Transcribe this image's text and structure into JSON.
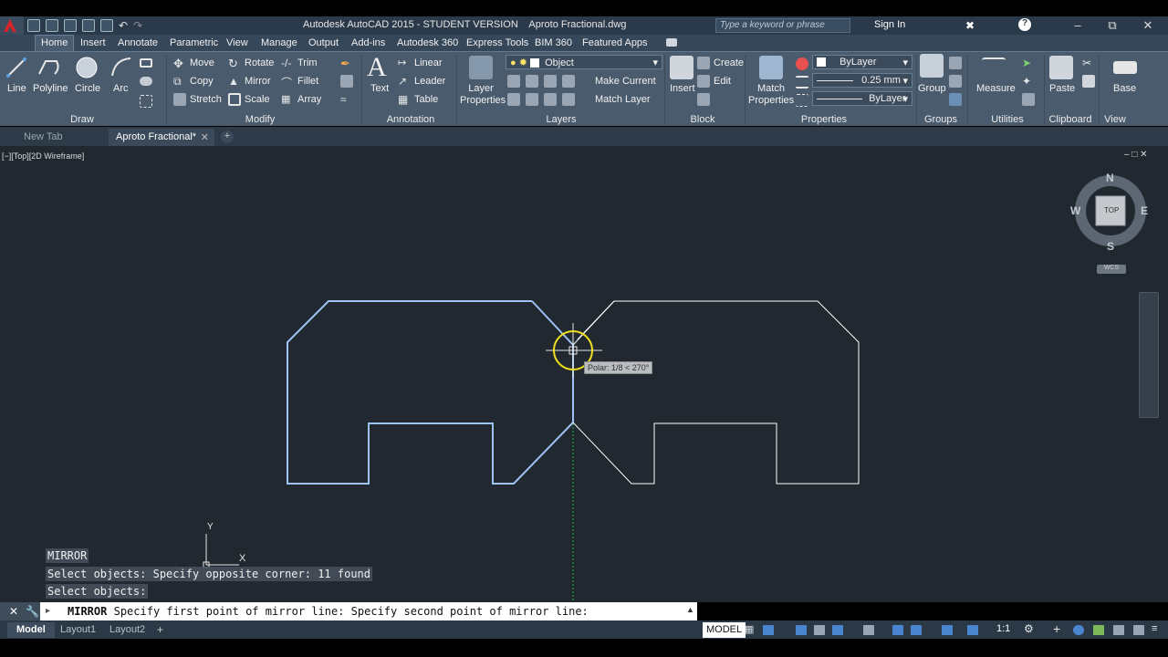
{
  "window": {
    "title": "Autodesk AutoCAD 2015 - STUDENT VERSION    Aproto Fractional.dwg",
    "search_placeholder": "Type a keyword or phrase",
    "sign_in": "Sign In"
  },
  "menu_tabs": [
    "Home",
    "Insert",
    "Annotate",
    "Parametric",
    "View",
    "Manage",
    "Output",
    "Add-ins",
    "Autodesk 360",
    "Express Tools",
    "BIM 360",
    "Featured Apps"
  ],
  "ribbon": {
    "draw": {
      "title": "Draw",
      "line": "Line",
      "polyline": "Polyline",
      "circle": "Circle",
      "arc": "Arc"
    },
    "modify": {
      "title": "Modify",
      "move": "Move",
      "rotate": "Rotate",
      "trim": "Trim",
      "copy": "Copy",
      "mirror": "Mirror",
      "fillet": "Fillet",
      "stretch": "Stretch",
      "scale": "Scale",
      "array": "Array"
    },
    "annotation": {
      "title": "Annotation",
      "text": "Text",
      "linear": "Linear",
      "leader": "Leader",
      "table": "Table"
    },
    "layers": {
      "title": "Layers",
      "layer_properties": "Layer Properties",
      "layer_name": "Object",
      "make_current": "Make Current",
      "match_layer": "Match Layer"
    },
    "block": {
      "title": "Block",
      "insert": "Insert",
      "create": "Create",
      "edit": "Edit"
    },
    "properties": {
      "title": "Properties",
      "match_properties": "Match Properties",
      "color": "ByLayer",
      "lineweight": "0.25 mm",
      "linetype": "ByLayer"
    },
    "groups": {
      "title": "Groups",
      "group": "Group"
    },
    "utilities": {
      "title": "Utilities",
      "measure": "Measure"
    },
    "clipboard": {
      "title": "Clipboard",
      "paste": "Paste"
    },
    "view": {
      "title": "View",
      "base": "Base"
    }
  },
  "doc_tabs": {
    "new_tab": "New Tab",
    "current": "Aproto Fractional*"
  },
  "viewport": {
    "label": "[−][Top][2D Wireframe]",
    "viewcube": {
      "top": "TOP",
      "n": "N",
      "s": "S",
      "e": "E",
      "w": "W",
      "wcs": "WCS"
    },
    "ucs": {
      "x": "X",
      "y": "Y"
    },
    "tooltip": "Polar: 1/8 < 270°"
  },
  "command_history": [
    "MIRROR",
    "Select objects: Specify opposite corner: 11 found",
    "Select objects:"
  ],
  "command_line": {
    "command": "MIRROR",
    "prompt": "Specify first point of mirror line: Specify second point of mirror line:"
  },
  "status_bar": {
    "tabs": [
      "Model",
      "Layout1",
      "Layout2"
    ],
    "model_label": "MODEL",
    "scale": "1:1"
  },
  "colors": {
    "selected_outline": "#9cc3f3",
    "crosshair_marker": "#f1e01e",
    "viewport_bg": "#212830",
    "mirror_line": "#2bb04a"
  }
}
